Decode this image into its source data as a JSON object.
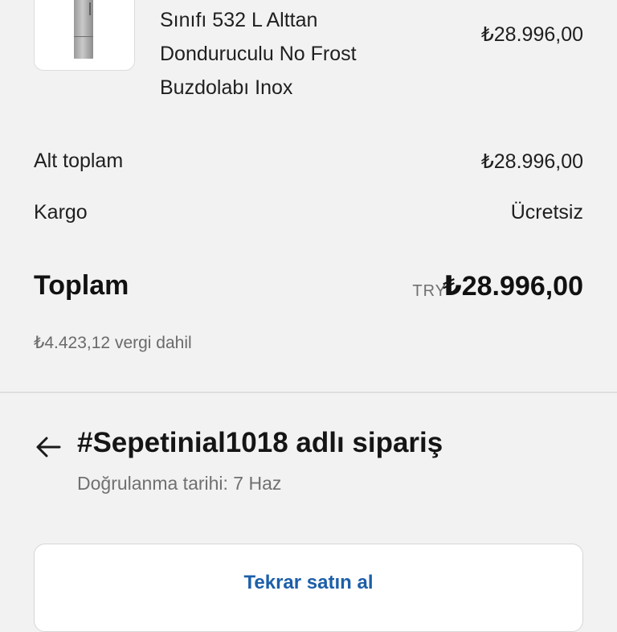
{
  "product": {
    "name_lines": [
      "Sınıfı 532 L Alttan",
      "Donduruculu No Frost",
      "Buzdolabı Inox"
    ],
    "price": "₺28.996,00",
    "image_icon": "refrigerator-image"
  },
  "summary": {
    "subtotal_label": "Alt toplam",
    "subtotal_value": "₺28.996,00",
    "shipping_label": "Kargo",
    "shipping_value": "Ücretsiz",
    "total_label": "Toplam",
    "total_currency": "TRY",
    "total_value": "₺28.996,00",
    "tax_note": "₺4.423,12 vergi dahil"
  },
  "order": {
    "back_icon": "arrow-left-icon",
    "title": "#Sepetinial1018 adlı sipariş",
    "confirmed": "Doğrulanma tarihi: 7 Haz"
  },
  "actions": {
    "rebuy_label": "Tekrar satın al"
  },
  "colors": {
    "background": "#f2f2f2",
    "accent_link": "#1c5fa8"
  }
}
